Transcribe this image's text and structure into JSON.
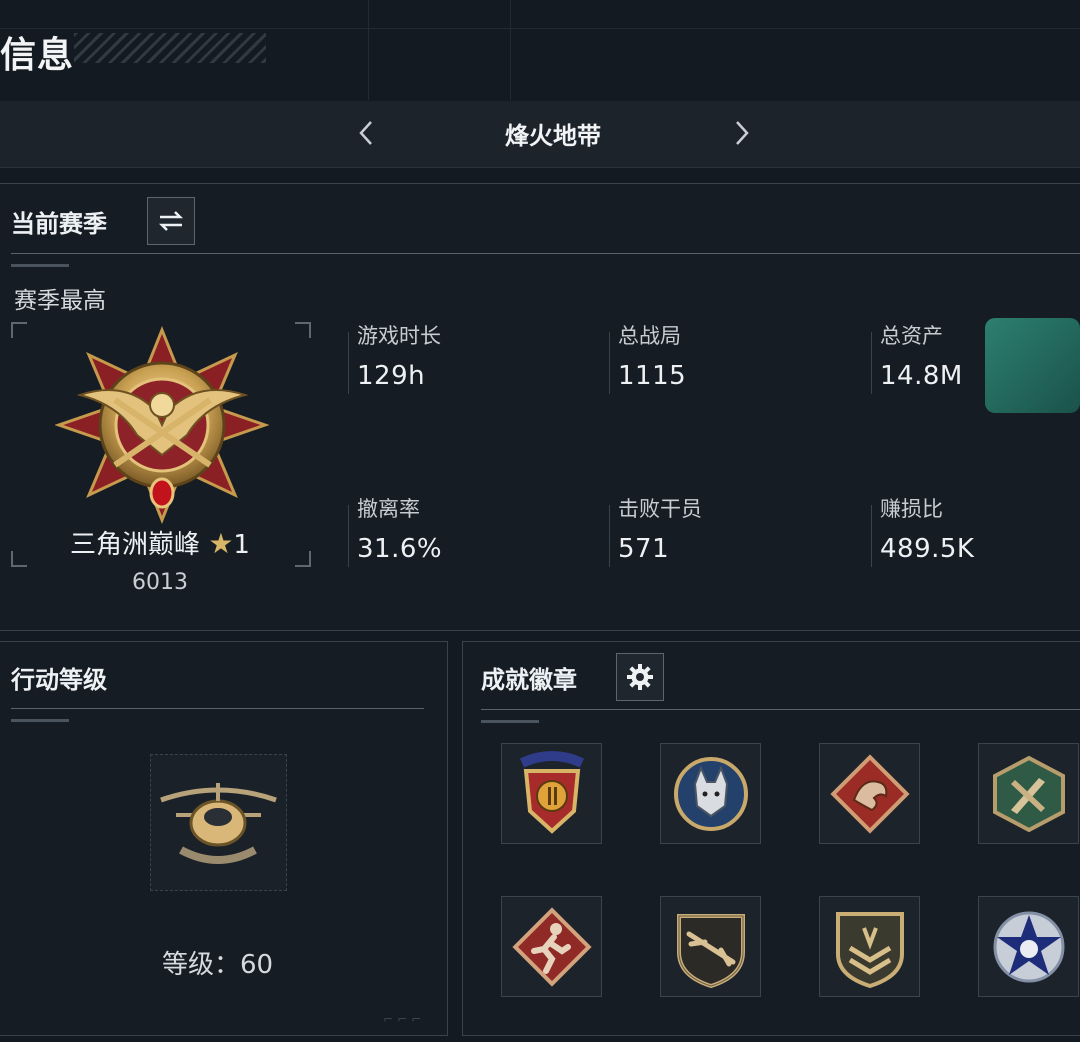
{
  "header": {
    "title": "信息"
  },
  "mode_selector": {
    "title": "烽火地带"
  },
  "season": {
    "section_title": "当前赛季",
    "best_label": "赛季最高",
    "rank_name": "三角洲巅峰",
    "rank_stars": "1",
    "rank_score": "6013",
    "stats": [
      {
        "label": "游戏时长",
        "value": "129h"
      },
      {
        "label": "总战局",
        "value": "1115"
      },
      {
        "label": "总资产",
        "value": "14.8M"
      },
      {
        "label": "撤离率",
        "value": "31.6%"
      },
      {
        "label": "击败干员",
        "value": "571"
      },
      {
        "label": "赚损比",
        "value": "489.5K"
      }
    ]
  },
  "action_level": {
    "section_title": "行动等级",
    "level_label": "等级：",
    "level_value": "60"
  },
  "badges": {
    "section_title": "成就徽章",
    "items": [
      {
        "icon": "shield-star-badge-icon"
      },
      {
        "icon": "lynx-badge-icon"
      },
      {
        "icon": "dragon-badge-icon"
      },
      {
        "icon": "weapons-badge-icon"
      },
      {
        "icon": "runner-badge-icon"
      },
      {
        "icon": "rifle-badge-icon"
      },
      {
        "icon": "chevron-shield-badge-icon"
      },
      {
        "icon": "star-emblem-badge-icon"
      }
    ]
  }
}
